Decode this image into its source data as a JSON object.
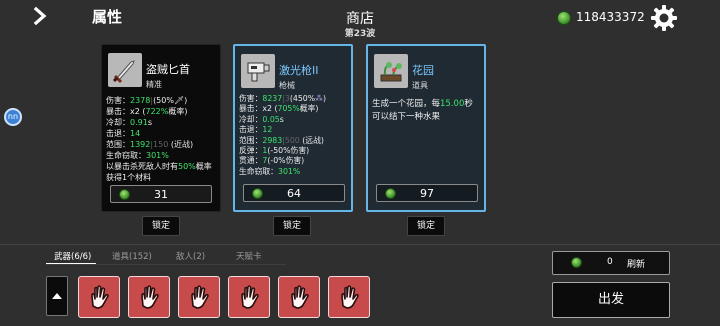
{
  "header": {
    "attributes_label": "属性",
    "shop_title": "商店",
    "wave": "第23波",
    "money": "118433372"
  },
  "colors": {
    "background": "#2f2f2f",
    "stat_green": "#3fe36d",
    "stat_yellow": "#f0c94d",
    "highlight_blue": "#66b5e8",
    "slot_red": "#c84b4b"
  },
  "side_bubble": {
    "text": "nn"
  },
  "cards": [
    {
      "name": "盗贼匕首",
      "subtitle": "精准",
      "icon": "dagger-icon",
      "stats": {
        "damage_label": "伤害：",
        "damage_value": "2378",
        "damage_extra": "|",
        "damage_pct": "(50%",
        "damage_suffix": ")",
        "crit_label": "暴击：",
        "crit_value": "x2 (",
        "crit_pct": "7",
        "crit_pct2": "22%",
        "crit_suffix": "概率)",
        "cooldown_label": "冷却：",
        "cooldown_value": "0.91",
        "cooldown_unit": "s",
        "knockback_label": "击退：",
        "knockback_value": "14",
        "range_label": "范围：",
        "range_value": "1392",
        "range_dim": "|150",
        "range_suffix": " (近战)",
        "lifesteal_label": "生命窃取：",
        "lifesteal_value": "301%",
        "special_pre": "以暴击杀死敌人时有",
        "special_pct": "50%",
        "special_post": "概率获得1个材料"
      },
      "price": "31",
      "lock_label": "锁定"
    },
    {
      "name": "激光枪II",
      "subtitle": "枪械",
      "icon": "laser-gun-icon",
      "stats": {
        "damage_label": "伤害：",
        "damage_value": "8237",
        "damage_dim": "|3",
        "damage_pct": "(450%",
        "damage_suffix": ")",
        "crit_label": "暴击：",
        "crit_value": "x2 (",
        "crit_pct": "705%",
        "crit_suffix": "概率)",
        "cooldown_label": "冷却：",
        "cooldown_value": "0.05",
        "cooldown_unit": "s",
        "knockback_label": "击退：",
        "knockback_value": "12",
        "range_label": "范围：",
        "range_value": "2983",
        "range_dim": "|500",
        "range_suffix": " (远战)",
        "bounce_label": "反弹：",
        "bounce_value": "1",
        "bounce_suffix": "(-50%伤害)",
        "pierce_label": "贯通：",
        "pierce_value": "7",
        "pierce_suffix": "(-0%伤害)",
        "lifesteal_label": "生命窃取：",
        "lifesteal_value": "301%"
      },
      "price": "64",
      "lock_label": "锁定"
    },
    {
      "name": "花园",
      "subtitle": "道具",
      "icon": "garden-icon",
      "desc_pre": "生成一个花园，每",
      "desc_num": "15.00",
      "desc_post": "秒可以结下一种水果",
      "price": "97",
      "lock_label": "锁定"
    }
  ],
  "tabs": [
    {
      "label": "武器(6/6)",
      "active": true
    },
    {
      "label": "道具(152)",
      "active": false
    },
    {
      "label": "敌人(2)",
      "active": false
    },
    {
      "label": "天赋卡",
      "active": false
    }
  ],
  "weapon_slots": [
    {
      "icon": "hand-icon"
    },
    {
      "icon": "hand-icon"
    },
    {
      "icon": "hand-icon"
    },
    {
      "icon": "hand-icon"
    },
    {
      "icon": "hand-icon"
    },
    {
      "icon": "hand-icon"
    }
  ],
  "refresh": {
    "cost": "0",
    "label": "刷新"
  },
  "depart_label": "出发"
}
